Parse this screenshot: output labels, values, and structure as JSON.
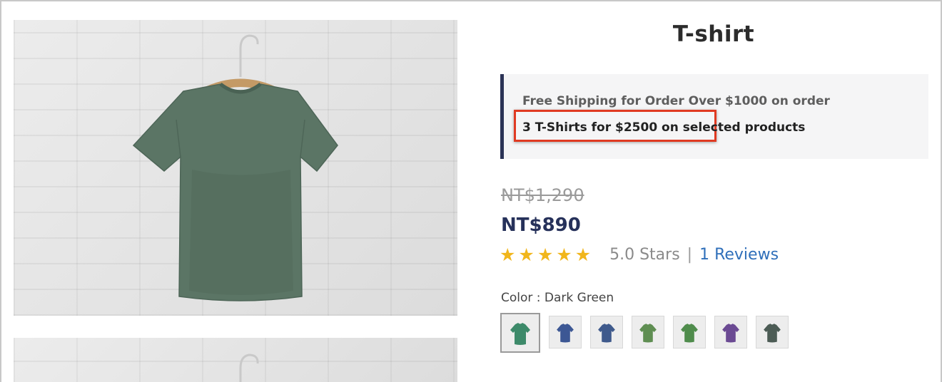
{
  "product": {
    "title": "T-shirt",
    "image_alt": "Dark green T-shirt on hanger"
  },
  "promo": {
    "line1": "Free Shipping for Order Over $1000 on order",
    "line2": "3 T-Shirts for $2500 on selected products",
    "accent_color": "#2b3356",
    "highlight_color": "#e03a22"
  },
  "pricing": {
    "original_price": "NT$1,290",
    "sale_price": "NT$890"
  },
  "rating": {
    "stars": 5,
    "text": "5.0 Stars",
    "separator": "|",
    "reviews_link": "1 Reviews",
    "star_color": "#f1b61c"
  },
  "color_option": {
    "label": "Color : Dark Green",
    "swatches": [
      {
        "name": "green",
        "color": "#3d8a6a",
        "selected": true
      },
      {
        "name": "navy",
        "color": "#3c5794",
        "selected": false
      },
      {
        "name": "blue",
        "color": "#3f5a8c",
        "selected": false
      },
      {
        "name": "olive-green",
        "color": "#5f8e52",
        "selected": false
      },
      {
        "name": "green-2",
        "color": "#4f8c4c",
        "selected": false
      },
      {
        "name": "purple",
        "color": "#6b4a93",
        "selected": false
      },
      {
        "name": "dark-green",
        "color": "#4c5c55",
        "selected": false
      }
    ]
  }
}
